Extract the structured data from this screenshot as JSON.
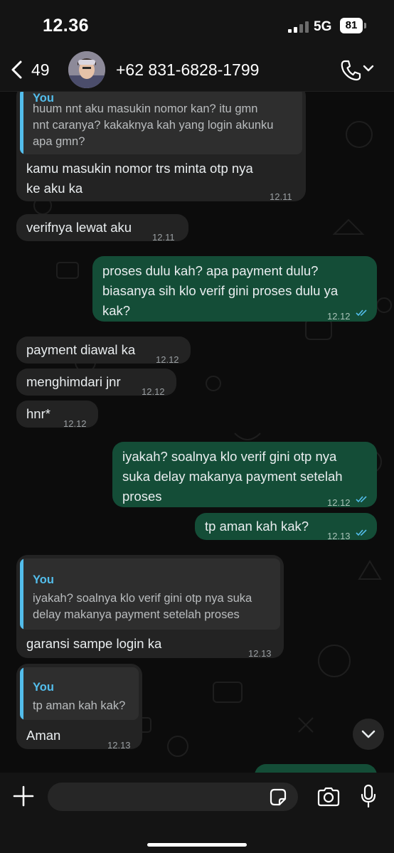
{
  "status": {
    "time": "12.36",
    "network": "5G",
    "battery": "81"
  },
  "header": {
    "unread_count": "49",
    "contact": "+62 831-6828-1799"
  },
  "messages": [
    {
      "dir": "in",
      "quote_author": "You",
      "quote_lines": [
        "huum nnt aku masukin nomor kan? itu gmn",
        "nnt caranya? kakaknya kah yang login akunku",
        "apa gmn?"
      ],
      "lines": [
        "kamu masukin nomor trs minta otp nya",
        "ke aku ka"
      ],
      "time": "12.11"
    },
    {
      "dir": "in",
      "lines": [
        "verifnya lewat aku"
      ],
      "time": "12.11"
    },
    {
      "dir": "out",
      "lines": [
        "proses dulu kah? apa payment dulu?",
        "biasanya sih klo verif gini proses dulu ya",
        "kak?"
      ],
      "time": "12.12"
    },
    {
      "dir": "in",
      "lines": [
        "payment diawal ka"
      ],
      "time": "12.12"
    },
    {
      "dir": "in",
      "lines": [
        "menghimdari jnr"
      ],
      "time": "12.12"
    },
    {
      "dir": "in",
      "lines": [
        "hnr*"
      ],
      "time": "12.12"
    },
    {
      "dir": "out",
      "lines": [
        "iyakah? soalnya klo verif gini otp nya",
        "suka delay makanya payment setelah",
        "proses"
      ],
      "time": "12.12"
    },
    {
      "dir": "out",
      "lines": [
        "tp aman kah kak?"
      ],
      "time": "12.13"
    },
    {
      "dir": "in",
      "quote_author": "You",
      "quote_lines": [
        "iyakah? soalnya klo verif gini otp nya suka",
        "delay makanya payment setelah proses"
      ],
      "lines": [
        "garansi sampe login ka"
      ],
      "time": "12.13"
    },
    {
      "dir": "in",
      "quote_author": "You",
      "quote_lines": [
        "tp aman kah kak?"
      ],
      "lines": [
        "Aman"
      ],
      "time": "12.13"
    }
  ],
  "composer": {
    "placeholder": ""
  },
  "colors": {
    "incoming": "#232323",
    "outgoing": "#144d37",
    "quote_accent": "#53bdeb",
    "read_ticks": "#53bdeb"
  }
}
